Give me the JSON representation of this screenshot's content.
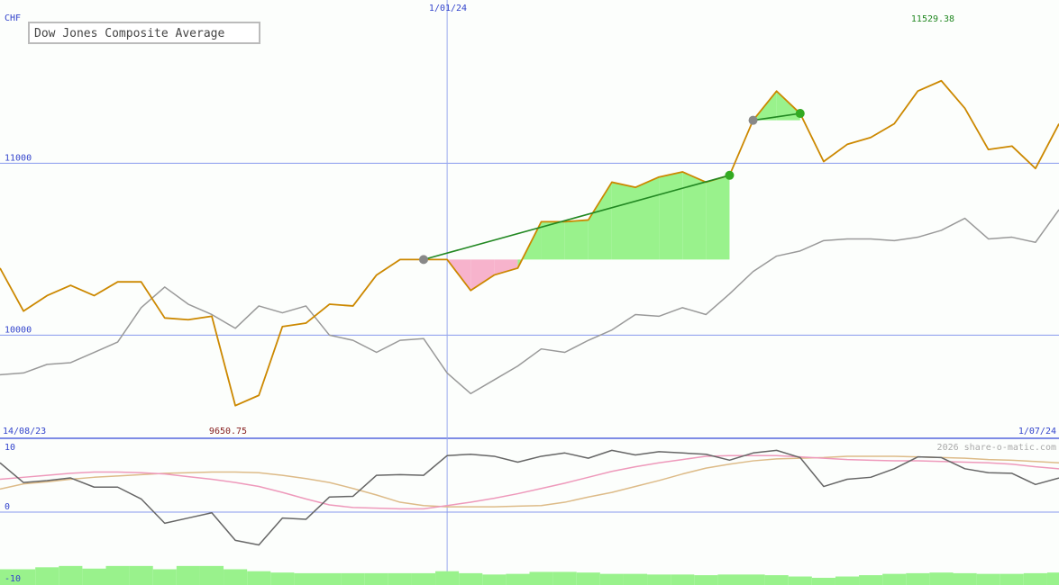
{
  "chart_data": [
    {
      "type": "line",
      "title": "Dow Jones Composite Average",
      "currency": "CHF",
      "high_label": "11529.38",
      "low_label": "9650.75",
      "date_start": "14/08/23",
      "date_mid": "1/01/24",
      "date_end": "1/07/24",
      "watermark": "2026 share-o-matic.com",
      "ylim": [
        9400,
        11950
      ],
      "y_ticks": [
        {
          "value": 10000,
          "label": "10000"
        },
        {
          "value": 11000,
          "label": "11000"
        }
      ],
      "x_count": 46,
      "x_mid_index": 19,
      "series": [
        {
          "color": "#cc8800",
          "values": [
            10390,
            10140,
            10230,
            10290,
            10230,
            10310,
            10310,
            10100,
            10090,
            10110,
            9590,
            9650,
            10050,
            10070,
            10180,
            10170,
            10350,
            10440,
            10440,
            10440,
            10260,
            10350,
            10390,
            10660,
            10660,
            10670,
            10890,
            10860,
            10920,
            10950,
            10890,
            10930,
            11250,
            11420,
            11290,
            11010,
            11110,
            11150,
            11230,
            11420,
            11480,
            11320,
            11080,
            11100,
            10970,
            11230
          ]
        },
        {
          "color": "#999999",
          "values": [
            9770,
            9780,
            9830,
            9840,
            9900,
            9960,
            10160,
            10280,
            10180,
            10120,
            10040,
            10170,
            10130,
            10170,
            10000,
            9970,
            9900,
            9970,
            9980,
            9780,
            9660,
            9740,
            9820,
            9920,
            9900,
            9970,
            10030,
            10120,
            10110,
            10160,
            10120,
            10240,
            10370,
            10460,
            10490,
            10550,
            10560,
            10560,
            10550,
            10570,
            10610,
            10680,
            10560,
            10570,
            10540,
            10730
          ]
        }
      ],
      "trend_lines": [
        {
          "from_index": 18,
          "from_value": 10440,
          "to_index": 31,
          "to_value": 10930
        },
        {
          "from_index": 32,
          "from_value": 11250,
          "to_index": 34,
          "to_value": 11290
        }
      ]
    },
    {
      "type": "line",
      "ylim": [
        -10,
        10
      ],
      "y_ticks": [
        {
          "value": 10,
          "label": "10"
        },
        {
          "value": 0,
          "label": "0"
        },
        {
          "value": -10,
          "label": "-10"
        }
      ],
      "series": [
        {
          "color": "#666666",
          "values": [
            7.5,
            4.5,
            4.8,
            5.2,
            3.8,
            3.8,
            2.0,
            -1.7,
            -0.9,
            -0.1,
            -4.3,
            -5.0,
            -0.9,
            -1.1,
            2.3,
            2.4,
            5.6,
            5.7,
            5.6,
            8.6,
            8.8,
            8.5,
            7.6,
            8.5,
            9.0,
            8.2,
            9.4,
            8.7,
            9.2,
            9.0,
            8.8,
            7.9,
            9.0,
            9.4,
            8.3,
            3.9,
            5.0,
            5.3,
            6.6,
            8.4,
            8.3,
            6.6,
            6.0,
            5.9,
            4.2,
            5.2
          ]
        },
        {
          "color": "#ee99bb",
          "values": [
            5.0,
            5.3,
            5.6,
            5.9,
            6.1,
            6.1,
            6.0,
            5.8,
            5.4,
            5.0,
            4.5,
            3.9,
            3.0,
            2.0,
            1.1,
            0.7,
            0.6,
            0.5,
            0.5,
            1.0,
            1.5,
            2.1,
            2.8,
            3.6,
            4.4,
            5.3,
            6.2,
            6.9,
            7.5,
            8.0,
            8.5,
            8.6,
            8.6,
            8.6,
            8.4,
            8.2,
            8.0,
            7.9,
            7.8,
            7.8,
            7.7,
            7.6,
            7.5,
            7.3,
            6.9,
            6.6
          ]
        },
        {
          "color": "#ddbb88",
          "values": [
            3.5,
            4.3,
            4.6,
            5.0,
            5.3,
            5.5,
            5.7,
            5.9,
            6.0,
            6.1,
            6.1,
            6.0,
            5.6,
            5.1,
            4.5,
            3.6,
            2.6,
            1.5,
            1.0,
            0.8,
            0.8,
            0.8,
            0.9,
            1.0,
            1.5,
            2.3,
            3.0,
            3.9,
            4.8,
            5.8,
            6.7,
            7.3,
            7.8,
            8.1,
            8.2,
            8.3,
            8.5,
            8.5,
            8.5,
            8.4,
            8.3,
            8.2,
            8.0,
            7.9,
            7.7,
            7.5
          ]
        }
      ],
      "bars": [
        -8.7,
        -8.7,
        -8.4,
        -8.2,
        -8.6,
        -8.2,
        -8.2,
        -8.7,
        -8.2,
        -8.2,
        -8.7,
        -9.0,
        -9.2,
        -9.3,
        -9.3,
        -9.3,
        -9.3,
        -9.3,
        -9.3,
        -9.0,
        -9.3,
        -9.5,
        -9.4,
        -9.1,
        -9.1,
        -9.2,
        -9.4,
        -9.4,
        -9.5,
        -9.5,
        -9.6,
        -9.5,
        -9.5,
        -9.6,
        -9.8,
        -10.0,
        -9.8,
        -9.6,
        -9.4,
        -9.3,
        -9.2,
        -9.3,
        -9.4,
        -9.4,
        -9.3,
        -9.2
      ]
    }
  ]
}
